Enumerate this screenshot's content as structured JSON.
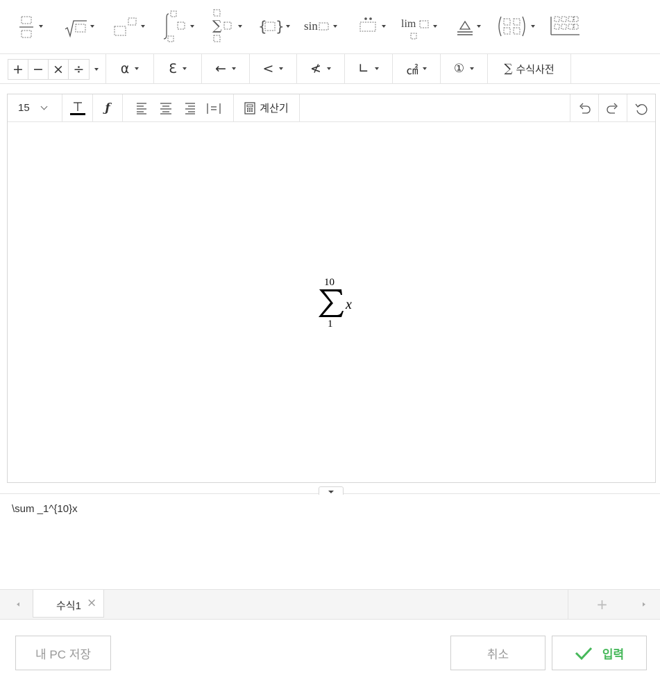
{
  "template_toolbar": {
    "items": [
      "fraction",
      "root",
      "superscript",
      "integral",
      "summation",
      "brackets",
      "function",
      "accent",
      "limit",
      "stacked",
      "matrix",
      "table"
    ],
    "function_label": "sin",
    "limit_label": "lim"
  },
  "symbol_toolbar": {
    "operators": [
      "+",
      "−",
      "×",
      "÷"
    ],
    "groups": [
      {
        "name": "greek",
        "label": "α"
      },
      {
        "name": "letterlike",
        "label": "Ɛ"
      },
      {
        "name": "arrows",
        "label": "←"
      },
      {
        "name": "relations",
        "label": "<"
      },
      {
        "name": "negated-relations",
        "label": "≮"
      },
      {
        "name": "geometry",
        "label": "∟"
      },
      {
        "name": "units",
        "label": "㎠"
      },
      {
        "name": "enclosed",
        "label": "①"
      }
    ],
    "dictionary": {
      "icon": "∑",
      "label": "수식사전"
    }
  },
  "format_toolbar": {
    "font_size": "15",
    "calculator_label": "계산기"
  },
  "formula": {
    "operator": "∑",
    "upper": "10",
    "lower": "1",
    "body": "x"
  },
  "latex_source": "\\sum _1^{10}x",
  "tabs": [
    {
      "label": "수식1",
      "close": "×"
    }
  ],
  "tab_add": "+",
  "footer": {
    "save_pc": "내 PC 저장",
    "cancel": "취소",
    "submit": "입력"
  },
  "colors": {
    "accent_green": "#46b85a",
    "border": "#dcdcdc"
  }
}
